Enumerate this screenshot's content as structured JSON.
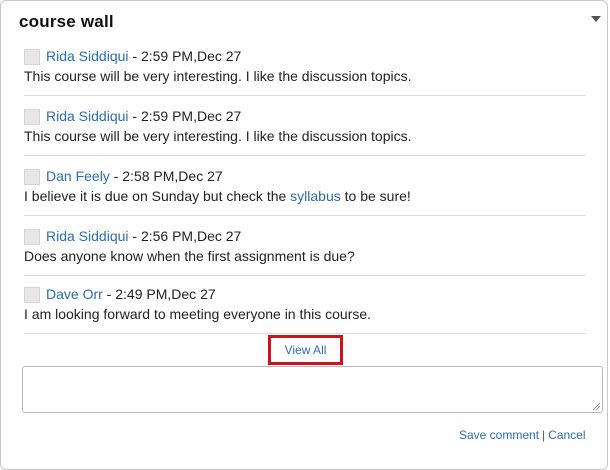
{
  "panel": {
    "title": "course wall",
    "collapse_icon": "triangle-down-icon"
  },
  "posts": [
    {
      "author": "Rida Siddiqui",
      "separator": " - ",
      "timestamp": "2:59 PM,Dec 27",
      "message": "This course will be very interesting. I like the discussion topics."
    },
    {
      "author": "Rida Siddiqui",
      "separator": " - ",
      "timestamp": "2:59 PM,Dec 27",
      "message": "This course will be very interesting. I like the discussion topics."
    },
    {
      "author": "Dan Feely",
      "separator": " - ",
      "timestamp": "2:58 PM,Dec 27",
      "message_before": "I believe it is due on Sunday but check the ",
      "message_link": "syllabus",
      "message_after": " to be sure!"
    },
    {
      "author": "Rida Siddiqui",
      "separator": " - ",
      "timestamp": "2:56 PM,Dec 27",
      "message": "Does anyone know when the first assignment is due?"
    },
    {
      "author": "Dave Orr",
      "separator": " - ",
      "timestamp": "2:49 PM,Dec 27",
      "message": "I am looking forward to meeting everyone in this course."
    }
  ],
  "view_all": {
    "label": "View All",
    "highlight_color": "#c8161d"
  },
  "comment": {
    "value": "",
    "placeholder": ""
  },
  "actions": {
    "save_label": "Save comment",
    "divider": "|",
    "cancel_label": "Cancel"
  },
  "colors": {
    "link": "#2a6db3",
    "text": "#222222",
    "border": "#c8c8c8"
  }
}
